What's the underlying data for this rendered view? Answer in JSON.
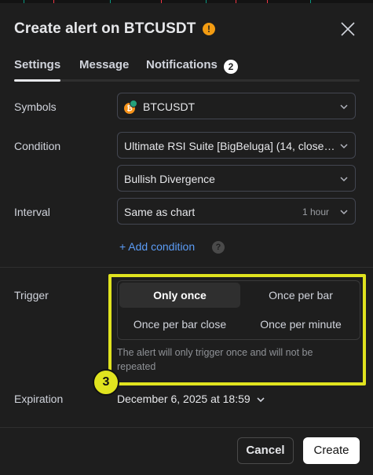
{
  "dialog": {
    "title": "Create alert on BTCUSDT",
    "warning_glyph": "!"
  },
  "tabs": [
    {
      "label": "Settings",
      "active": true
    },
    {
      "label": "Message",
      "active": false
    },
    {
      "label": "Notifications",
      "active": false,
      "badge": "2"
    }
  ],
  "symbols": {
    "label": "Symbols",
    "value": "BTCUSDT",
    "icon": "btc-usdt-coin-icon",
    "btc_glyph": "₿"
  },
  "condition": {
    "label": "Condition",
    "indicator": "Ultimate RSI Suite [BigBeluga] (14, close…",
    "signal": "Bullish Divergence"
  },
  "interval": {
    "label": "Interval",
    "value": "Same as chart",
    "hint": "1 hour"
  },
  "add_condition": {
    "label": "+ Add condition",
    "help": "?"
  },
  "trigger": {
    "label": "Trigger",
    "options": [
      "Only once",
      "Once per bar",
      "Once per bar close",
      "Once per minute"
    ],
    "selected": "Only once",
    "description": "The alert will only trigger once and will not be repeated"
  },
  "step_marker": "3",
  "expiration": {
    "label": "Expiration",
    "value": "December 6, 2025 at 18:59"
  },
  "footer": {
    "cancel": "Cancel",
    "create": "Create"
  },
  "colors": {
    "background": "#1e1e1e",
    "accent_link": "#5b9cf6",
    "highlight": "#e0e31f",
    "warning": "#f39c12",
    "primary_button": "#ffffff"
  }
}
